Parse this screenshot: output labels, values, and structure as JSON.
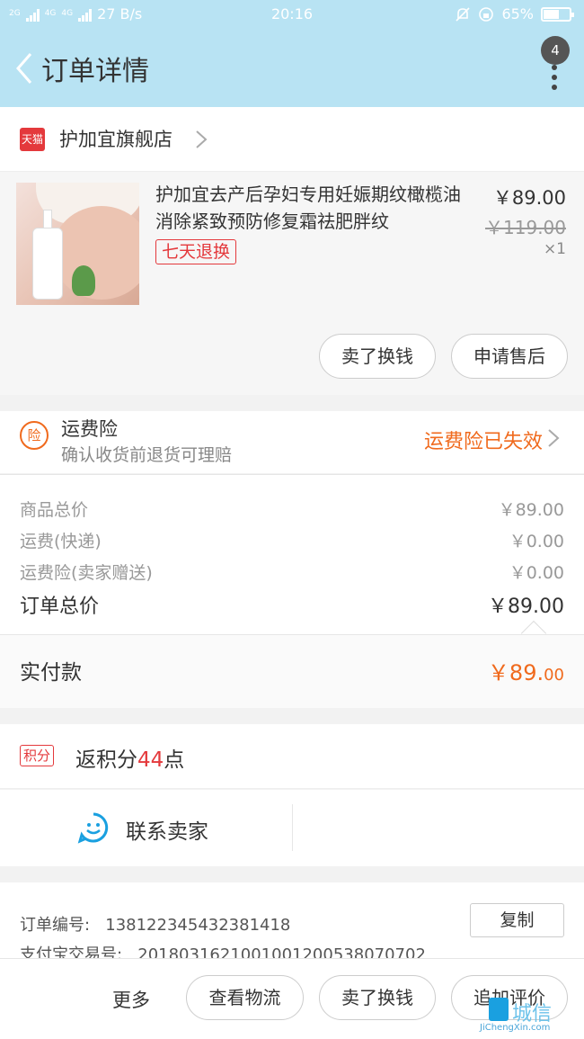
{
  "status_bar": {
    "network_1": "2G",
    "network_2": "4G",
    "network_3": "4G",
    "speed": "27 B/s",
    "time": "20:16",
    "battery": "65%",
    "battery_level": 0.65
  },
  "header": {
    "title": "订单详情",
    "badge_count": "4"
  },
  "shop": {
    "logo_text": "天猫",
    "name": "护加宜旗舰店"
  },
  "product": {
    "title": "护加宜去产后孕妇专用妊娠期纹橄榄油消除紧致预防修复霜祛肥胖纹",
    "tag": "七天退换",
    "price": "￥89.00",
    "original_price": "￥119.00",
    "quantity": "×1",
    "buttons": [
      "卖了换钱",
      "申请售后"
    ]
  },
  "insurance": {
    "icon_text": "险",
    "title": "运费险",
    "subtitle": "确认收货前退货可理赔",
    "status": "运费险已失效"
  },
  "summary": {
    "rows": [
      {
        "label": "商品总价",
        "value": "￥89.00"
      },
      {
        "label": "运费(快递)",
        "value": "￥0.00"
      },
      {
        "label": "运费险(卖家赠送)",
        "value": "￥0.00"
      }
    ],
    "total_label": "订单总价",
    "total_value": "￥89.00"
  },
  "paid": {
    "label": "实付款",
    "value_main": "￥89.",
    "value_cents": "00"
  },
  "points": {
    "badge": "积分",
    "prefix": "返积分",
    "number": "44",
    "suffix": "点"
  },
  "contact": {
    "label": "联系卖家"
  },
  "order_info": {
    "order_no_label": "订单编号:",
    "order_no": "1381223454323814​18",
    "alipay_label": "支付宝交易号:",
    "alipay_no": "2018031621001001200538070702",
    "copy_label": "复制"
  },
  "bottom_bar": {
    "more": "更多",
    "buttons": [
      "查看物流",
      "卖了换钱",
      "追加评价"
    ]
  },
  "watermark": {
    "text": "城信",
    "url": "JiChengXin.com"
  },
  "colors": {
    "header_bg": "#b8e3f3",
    "accent_orange": "#f06a1d",
    "accent_red": "#e4393c"
  }
}
